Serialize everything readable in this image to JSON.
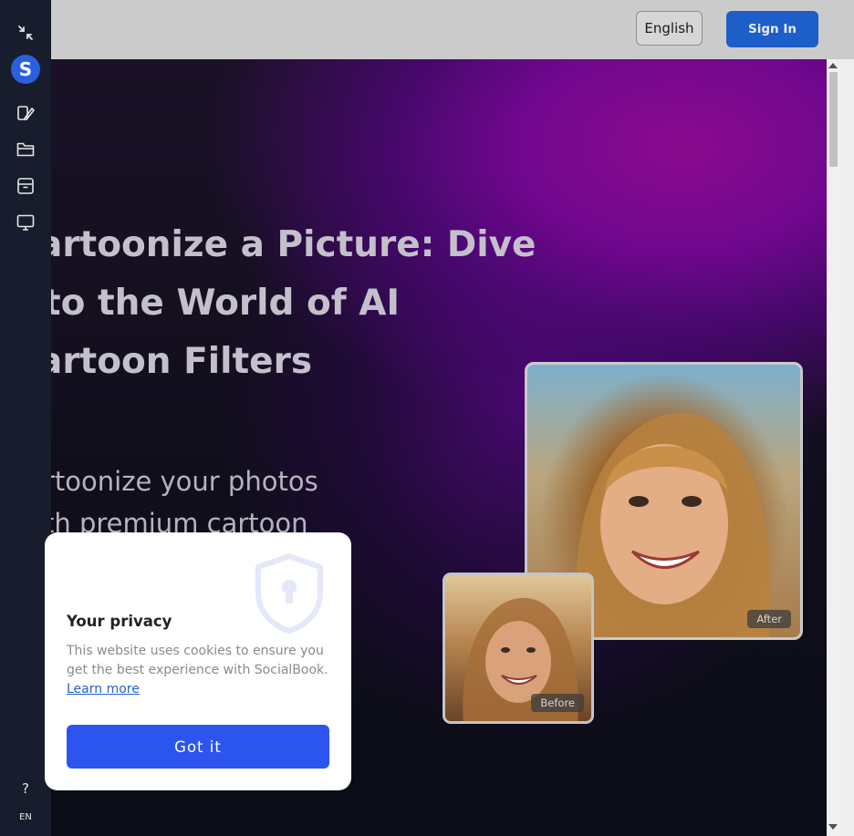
{
  "header": {
    "language_label": "English",
    "signin_label": "Sign In"
  },
  "sidebar": {
    "logo_letter": "S",
    "items": [
      {
        "icon": "collapse-icon"
      },
      {
        "icon": "edit-image-icon"
      },
      {
        "icon": "folder-icon"
      },
      {
        "icon": "archive-icon"
      },
      {
        "icon": "monitor-icon"
      }
    ],
    "help_label": "?",
    "lang_code": "EN"
  },
  "hero": {
    "headline_lines": [
      "artoonize a Picture: Dive",
      "to the World of AI",
      "artoon Filters"
    ],
    "subtitle_lines": [
      "rtoonize your photos",
      "th premium cartoon"
    ],
    "after_label": "After",
    "before_label": "Before"
  },
  "cookie": {
    "title": "Your privacy",
    "text": "This website uses cookies to ensure you get the best experience with SocialBook.",
    "link_label": "Learn more",
    "button_label": "Got it"
  },
  "colors": {
    "accent": "#2c55ef",
    "signin": "#1d5ec9",
    "sidebar": "#181d2d",
    "hero_purple": "#8b0a8e"
  }
}
